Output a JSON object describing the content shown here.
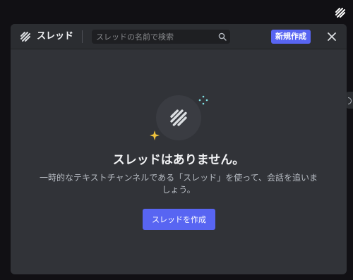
{
  "top_bar": {
    "threads_icon": "threads-icon"
  },
  "threads_panel": {
    "header": {
      "icon": "threads-icon",
      "title": "スレッド",
      "search": {
        "placeholder": "スレッドの名前で検索",
        "value": ""
      },
      "create_label": "新規作成",
      "close_icon": "close-icon"
    },
    "empty_state": {
      "title": "スレッドはありません。",
      "description": "一時的なテキストチャンネルである「スレッド」を使って、会話を追いましょう。",
      "button_label": "スレッドを作成"
    }
  },
  "colors": {
    "accent": "#5865f2",
    "panel_bg": "#313338",
    "header_bg": "#2b2d31",
    "page_bg": "#111014",
    "sparkle_cyan": "#7fe3e6",
    "sparkle_yellow": "#f0c33c"
  }
}
